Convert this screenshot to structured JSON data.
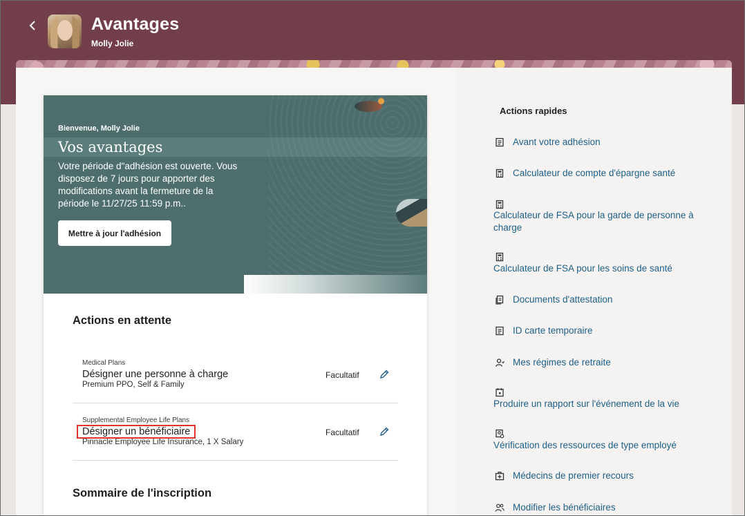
{
  "header": {
    "title": "Avantages",
    "subtitle": "Molly Jolie"
  },
  "hero": {
    "welcome": "Bienvenue, Molly Jolie",
    "title": "Vos avantages",
    "description": "Votre période d\"adhésion est ouverte. Vous disposez de 7 jours pour apporter des modifications avant la fermeture de la période le 11/27/25 11:59 p.m..",
    "button_label": "Mettre à jour l'adhésion"
  },
  "pending": {
    "title": "Actions en attente",
    "rows": [
      {
        "category": "Medical Plans",
        "name": "Désigner une personne à charge",
        "detail": "Premium PPO, Self & Family",
        "status": "Facultatif"
      },
      {
        "category": "Supplemental Employee Life Plans",
        "name": "Désigner un bénéficiaire",
        "detail": "Pinnacle Employee Life Insurance, 1 X Salary",
        "status": "Facultatif"
      }
    ]
  },
  "summary": {
    "title": "Sommaire de l'inscription"
  },
  "quick_actions": {
    "title": "Actions rapides",
    "items": [
      {
        "label": "Avant votre adhésion",
        "icon": "document-icon"
      },
      {
        "label": "Calculateur de compte d'épargne santé",
        "icon": "calculator-icon"
      },
      {
        "label": "Calculateur de FSA pour la garde de personne à charge",
        "icon": "calculator-icon"
      },
      {
        "label": "Calculateur de FSA pour les soins de santé",
        "icon": "calculator-icon"
      },
      {
        "label": "Documents d'attestation",
        "icon": "documents-icon"
      },
      {
        "label": "ID carte temporaire",
        "icon": "id-card-icon"
      },
      {
        "label": "Mes régimes de retraite",
        "icon": "person-icon"
      },
      {
        "label": "Produire un rapport sur l'événement de la vie",
        "icon": "calendar-icon"
      },
      {
        "label": "Vérification des ressources de type employé",
        "icon": "verify-icon"
      },
      {
        "label": "Médecins de premier recours",
        "icon": "medical-icon"
      },
      {
        "label": "Modifier les bénéficiaires",
        "icon": "people-icon"
      }
    ]
  },
  "colors": {
    "header_bg": "#723e4a",
    "hero_bg": "#4e6e6d",
    "link": "#1d5f88",
    "highlight": "#e0322e"
  }
}
